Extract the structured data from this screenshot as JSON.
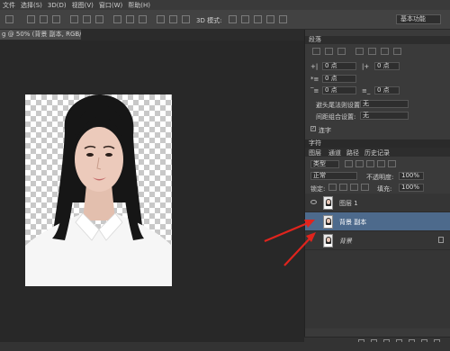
{
  "menu": [
    "文件",
    "选择(S)",
    "3D(D)",
    "视图(V)",
    "窗口(W)",
    "帮助(H)"
  ],
  "options": {
    "mode3d": "3D 模式:",
    "workspace": "基本功能"
  },
  "document_tab": {
    "title": "g @ 50% (背景 副本, RGB/8) *",
    "close": "×"
  },
  "paragraph_panel": {
    "title": "段落",
    "indent_left": "0 点",
    "indent_right": "0 点",
    "indent_first": "0 点",
    "space_before": "0 点",
    "space_after": "0 点",
    "avoid_label": "避头尾法则设置:",
    "avoid_value": "无",
    "composer_label": "间距组合设置:",
    "composer_value": "无",
    "hyphen_label": "连字"
  },
  "character_tab": "字符",
  "layers_panel": {
    "tabs": [
      "图层",
      "通道",
      "路径",
      "历史记录"
    ],
    "filter_kind": "类型",
    "blend_mode": "正常",
    "opacity_label": "不透明度:",
    "opacity_value": "100%",
    "lock_label": "锁定:",
    "fill_label": "填充:",
    "fill_value": "100%",
    "layers": [
      {
        "name": "图层 1",
        "selected": false,
        "visible": true,
        "locked": false
      },
      {
        "name": "背景 副本",
        "selected": true,
        "visible": false,
        "locked": false
      },
      {
        "name": "背景",
        "selected": false,
        "visible": false,
        "locked": true
      }
    ]
  },
  "colors": {
    "arrow": "#e0241d",
    "selected_layer": "#4d6a8c"
  }
}
